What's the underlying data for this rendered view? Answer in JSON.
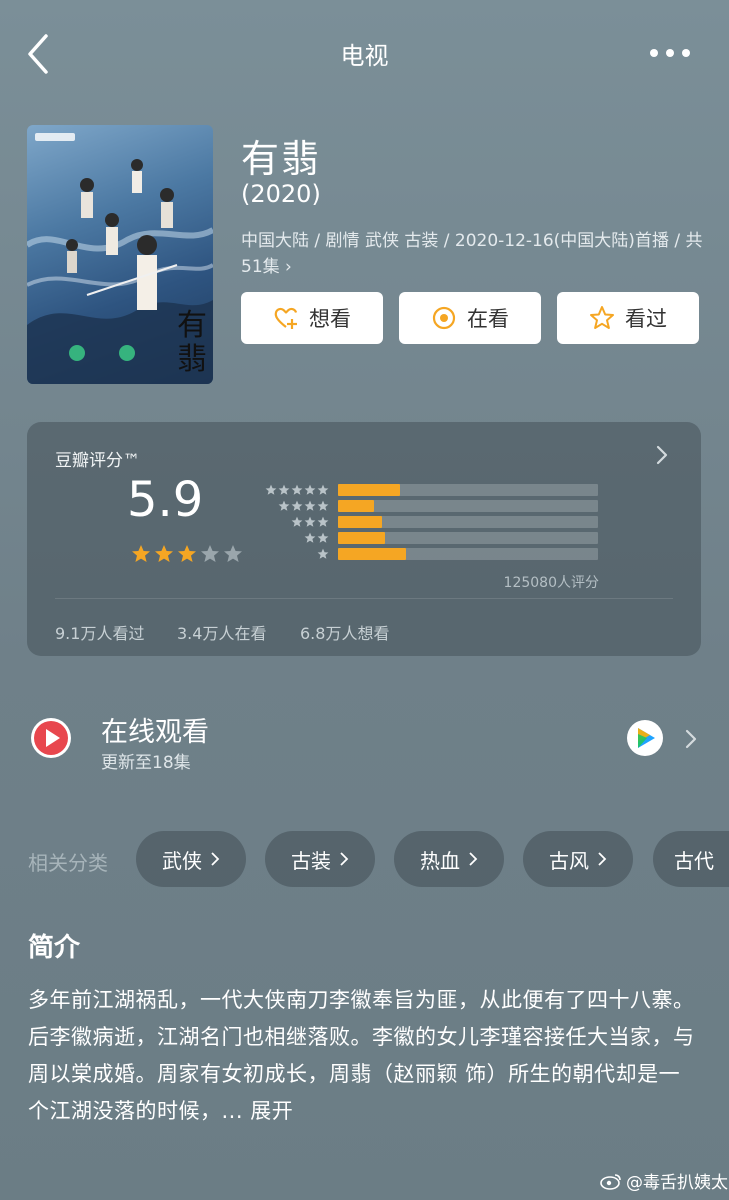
{
  "header": {
    "title": "电视"
  },
  "show": {
    "title": "有翡",
    "year": "(2020)",
    "meta": "中国大陆 / 剧情 武侠 古装 / 2020-12-16(中国大陆)首播 / 共51集 ›"
  },
  "actions": [
    {
      "label": "想看",
      "icon": "heart-plus-icon"
    },
    {
      "label": "在看",
      "icon": "target-icon"
    },
    {
      "label": "看过",
      "icon": "star-icon"
    }
  ],
  "rating": {
    "label": "豆瓣评分™",
    "score": "5.9",
    "stars_filled": 3,
    "stars_total": 5,
    "distribution": [
      {
        "stars": 5,
        "fraction": 0.24
      },
      {
        "stars": 4,
        "fraction": 0.14
      },
      {
        "stars": 3,
        "fraction": 0.17
      },
      {
        "stars": 2,
        "fraction": 0.18
      },
      {
        "stars": 1,
        "fraction": 0.26
      }
    ],
    "count": "125080人评分",
    "stats": [
      "9.1万人看过",
      "3.4万人在看",
      "6.8万人想看"
    ],
    "accent": "#f5a623"
  },
  "watch": {
    "title": "在线观看",
    "subtitle": "更新至18集",
    "provider_icon": "tencent-video-icon",
    "play_color": "#e8474e"
  },
  "categories": {
    "label": "相关分类",
    "items": [
      "武侠",
      "古装",
      "热血",
      "古风",
      "古代"
    ]
  },
  "intro": {
    "title": "简介",
    "text": "多年前江湖祸乱，一代大侠南刀李徽奉旨为匪，从此便有了四十八寨。后李徽病逝，江湖名门也相继落败。李徽的女儿李瑾容接任大当家，与周以棠成婚。周家有女初成长，周翡（赵丽颖 饰）所生的朝代却是一个江湖没落的时候，...",
    "more": "展开"
  },
  "watermark": "@毒舌扒姨太"
}
